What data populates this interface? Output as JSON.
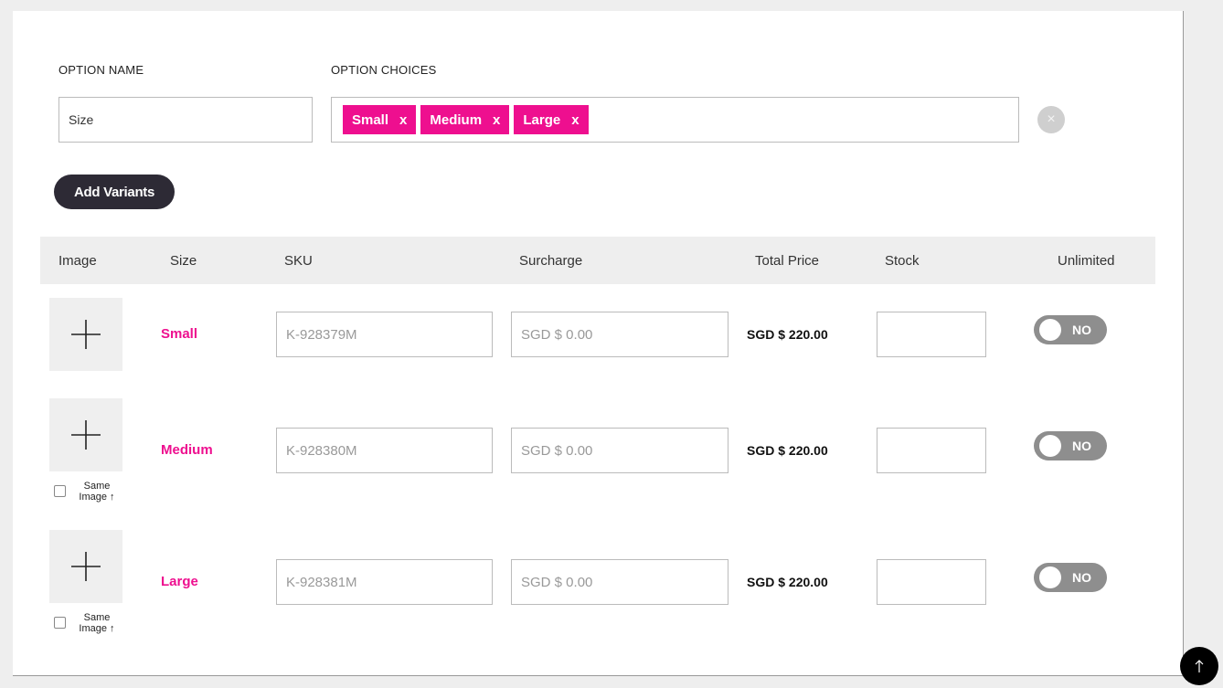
{
  "option": {
    "name_label": "OPTION NAME",
    "choices_label": "OPTION CHOICES",
    "name_value": "Size",
    "choices": [
      {
        "label": "Small",
        "remove": "x"
      },
      {
        "label": "Medium",
        "remove": "x"
      },
      {
        "label": "Large",
        "remove": "x"
      }
    ],
    "clear_icon": "×"
  },
  "add_variants_label": "Add Variants",
  "table": {
    "headers": {
      "image": "Image",
      "size": "Size",
      "sku": "SKU",
      "surcharge": "Surcharge",
      "total": "Total Price",
      "stock": "Stock",
      "unlimited": "Unlimited"
    },
    "rows": [
      {
        "size": "Small",
        "sku_placeholder": "K-928379M",
        "surcharge_placeholder": "SGD $ 0.00",
        "total": "SGD $ 220.00",
        "stock": "",
        "unlimited": "NO"
      },
      {
        "size": "Medium",
        "sku_placeholder": "K-928380M",
        "surcharge_placeholder": "SGD $ 0.00",
        "total": "SGD $ 220.00",
        "stock": "",
        "unlimited": "NO",
        "same_image_line1": "Same",
        "same_image_line2": "Image ↑"
      },
      {
        "size": "Large",
        "sku_placeholder": "K-928381M",
        "surcharge_placeholder": "SGD $ 0.00",
        "total": "SGD $ 220.00",
        "stock": "",
        "unlimited": "NO",
        "same_image_line1": "Same",
        "same_image_line2": "Image ↑"
      }
    ]
  },
  "colors": {
    "accent": "#ee0f8f",
    "button_dark": "#2d2a35",
    "toggle_off": "#8e8e8e"
  },
  "icons": {
    "add_image": "plus-icon",
    "clear": "close-icon",
    "scroll_top": "arrow-up-icon"
  }
}
